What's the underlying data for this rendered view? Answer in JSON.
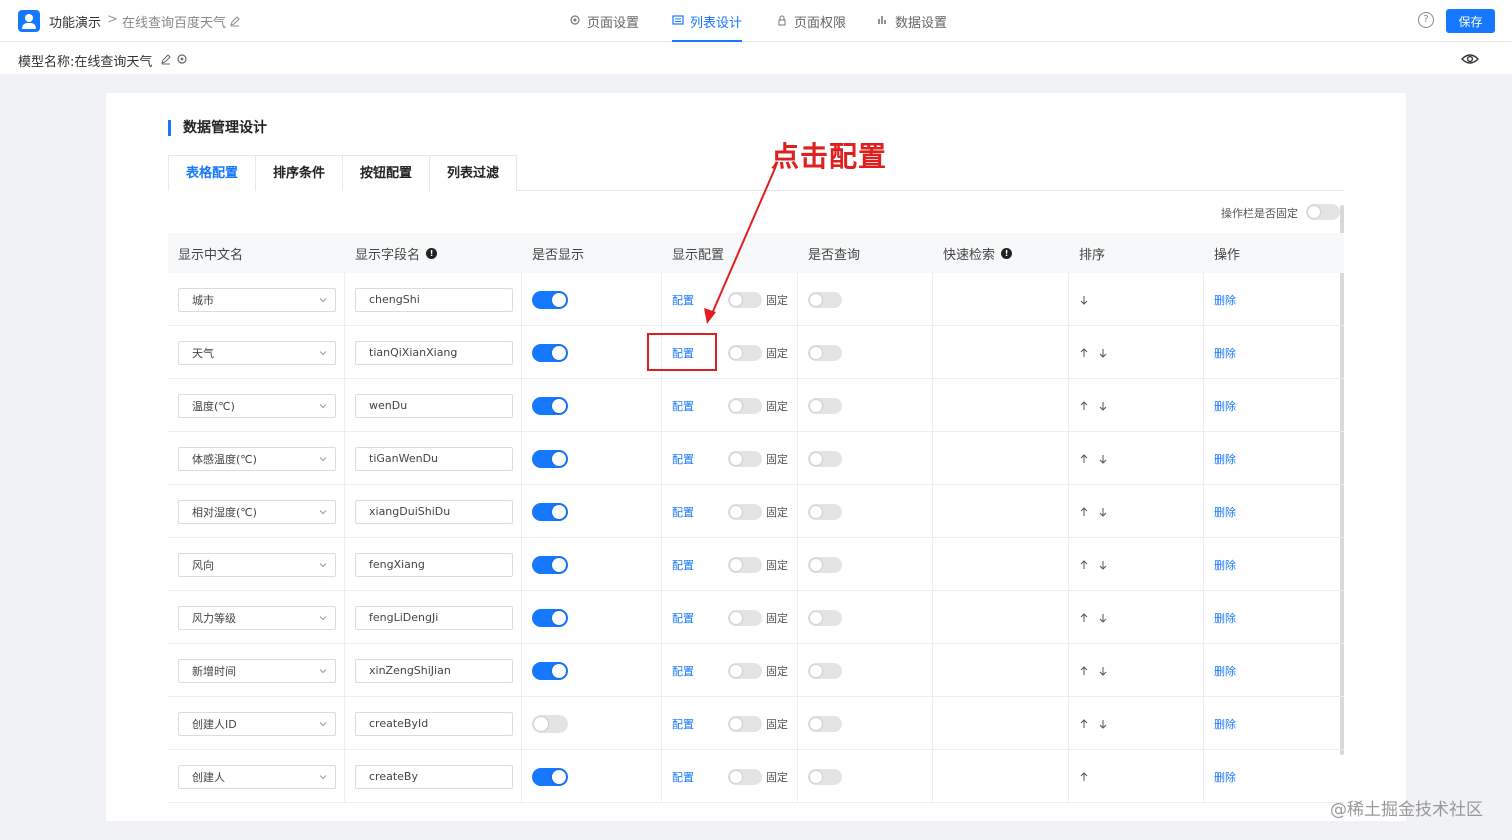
{
  "header": {
    "app_name": "功能演示",
    "separator": ">",
    "page_name": "在线查询百度天气",
    "nav_tabs": [
      {
        "label": "页面设置",
        "icon": "gear-icon"
      },
      {
        "label": "列表设计",
        "icon": "list-icon"
      },
      {
        "label": "页面权限",
        "icon": "lock-icon"
      },
      {
        "label": "数据设置",
        "icon": "bar-chart-icon"
      }
    ],
    "help_symbol": "?",
    "save_label": "保存"
  },
  "subheader": {
    "model_label": "模型名称:在线查询天气"
  },
  "card": {
    "section_title": "数据管理设计",
    "tabs": [
      "表格配置",
      "排序条件",
      "按钮配置",
      "列表过滤"
    ],
    "fix_toolbar_label": "操作栏是否固定",
    "fix_toolbar_on": false,
    "columns": [
      "显示中文名",
      "显示字段名",
      "是否显示",
      "显示配置",
      "是否查询",
      "快速检索",
      "排序",
      "操作"
    ],
    "config_link": "配置",
    "fixed_label": "固定",
    "delete_link": "删除",
    "rows": [
      {
        "cn": "城市",
        "field": "chengShi",
        "show": true,
        "up": false,
        "down": true
      },
      {
        "cn": "天气",
        "field": "tianQiXianXiang",
        "show": true,
        "up": true,
        "down": true
      },
      {
        "cn": "温度(℃)",
        "field": "wenDu",
        "show": true,
        "up": true,
        "down": true
      },
      {
        "cn": "体感温度(℃)",
        "field": "tiGanWenDu",
        "show": true,
        "up": true,
        "down": true
      },
      {
        "cn": "相对湿度(℃)",
        "field": "xiangDuiShiDu",
        "show": true,
        "up": true,
        "down": true
      },
      {
        "cn": "风向",
        "field": "fengXiang",
        "show": true,
        "up": true,
        "down": true
      },
      {
        "cn": "风力等级",
        "field": "fengLiDengJi",
        "show": true,
        "up": true,
        "down": true
      },
      {
        "cn": "新增时间",
        "field": "xinZengShiJian",
        "show": true,
        "up": true,
        "down": true
      },
      {
        "cn": "创建人ID",
        "field": "createById",
        "show": false,
        "up": true,
        "down": true
      },
      {
        "cn": "创建人",
        "field": "createBy",
        "show": true,
        "up": true,
        "down": false
      }
    ]
  },
  "annotation": {
    "text": "点击配置",
    "color": "#e02020"
  },
  "footer_watermark": "@稀土掘金技术社区",
  "colors": {
    "accent": "#1677ff",
    "annotation": "#e02020"
  }
}
